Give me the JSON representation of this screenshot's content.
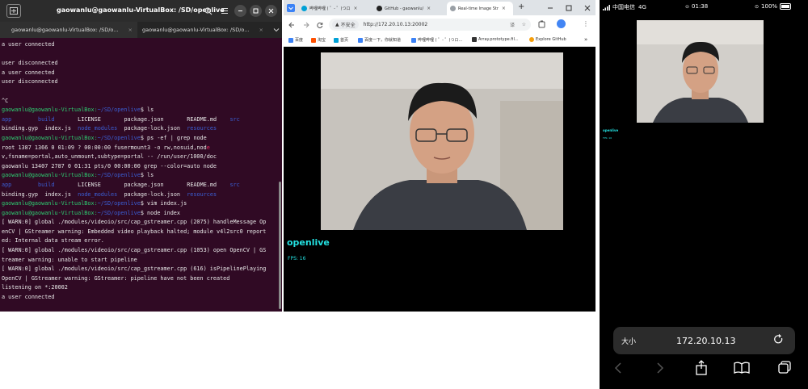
{
  "terminal": {
    "title": "gaowanlu@gaowanlu-VirtualBox: /SD/openlive",
    "tabs": [
      {
        "label": "gaowanlu@gaowanlu-VirtualBox: /SD/o...",
        "close": "×"
      },
      {
        "label": "gaowanlu@gaowanlu-VirtualBox: /SD/o...",
        "close": "×"
      }
    ],
    "prompt_user": "gaowanlu@gaowanlu-VirtualBox:",
    "prompt_path": "~/SD/openlive",
    "lines": [
      "a user connected",
      "",
      "user disconnected",
      "a user connected",
      "user disconnected",
      "",
      "^C",
      "$ ls",
      "app  build  LICENSE  package.json  README.md  src",
      "binding.gyp  index.js  node_modules  package-lock.json  resources",
      "$ ps -ef | grep node",
      "root  1387  1366  0 01:09 ?  00:00:00 fusermount3 -o rw,nosuid,nod",
      "v,fsname=portal,auto_unmount,subtype=portal -- /run/user/1000/doc",
      "gaowanlu  13407  2787  0 01:31 pts/0  00:00:00 grep --color=auto node",
      "$ ls",
      "app  build  LICENSE  package.json  README.md  src",
      "binding.gyp  index.js  node_modules  package-lock.json  resources",
      "$ vim index.js",
      "$ node index",
      "[ WARN:0] global ./modules/videoio/src/cap_gstreamer.cpp (2075) handleMessage Op",
      "enCV | GStreamer warning: Embedded video playback halted; module v4l2src0 report",
      "ed: Internal data stream error.",
      "[ WARN:0] global ./modules/videoio/src/cap_gstreamer.cpp (1053) open OpenCV | GS",
      "treamer warning: unable to start pipeline",
      "[ WARN:0] global ./modules/videoio/src/cap_gstreamer.cpp (616) isPipelinePlaying",
      " OpenCV | GStreamer warning: GStreamer: pipeline have not been created",
      "listening on *:20002",
      "a user connected"
    ],
    "ls_row1": [
      "app",
      "build",
      "LICENSE",
      "package.json",
      "README.md",
      "src"
    ],
    "ls_row2": [
      "binding.gyp",
      "index.js",
      "node_modules",
      "package-lock.json",
      "resources"
    ]
  },
  "browser": {
    "tabs": [
      {
        "label": "哔哩哔哩 ( ゜- ゜)つロ",
        "close": "×"
      },
      {
        "label": "GitHub - gaowanlu/",
        "close": "×"
      },
      {
        "label": "Real-time Image Str",
        "close": "×"
      }
    ],
    "new_tab": "+",
    "security_label": "不安全",
    "url": "http://172.20.10.13:20002",
    "bookmarks": [
      "百度",
      "淘宝",
      "首页",
      "百度一下，你就知道",
      "哔哩哔哩 ( ゜- ゜)つロ...",
      "Array.prototype.fil...",
      "Explore GitHub"
    ],
    "bookmarks_more": "»",
    "page": {
      "app_name": "openlive",
      "fps_text": "FPS: 16"
    },
    "colors": {
      "page_text": "#23e0e0",
      "tabstrip": "#dfe3e7"
    }
  },
  "phone": {
    "carrier": "中国电信",
    "network": "4G",
    "time": "01:38",
    "battery": "100%",
    "page": {
      "app_name": "openlive",
      "fps_text": "FPS: 16"
    },
    "address_bar": {
      "text_size_label": "大小",
      "url": "172.20.10.13",
      "reload_icon": "reload-icon"
    },
    "nav_icons": [
      "back-icon",
      "forward-icon",
      "share-icon",
      "bookmarks-icon",
      "tabs-icon"
    ]
  }
}
